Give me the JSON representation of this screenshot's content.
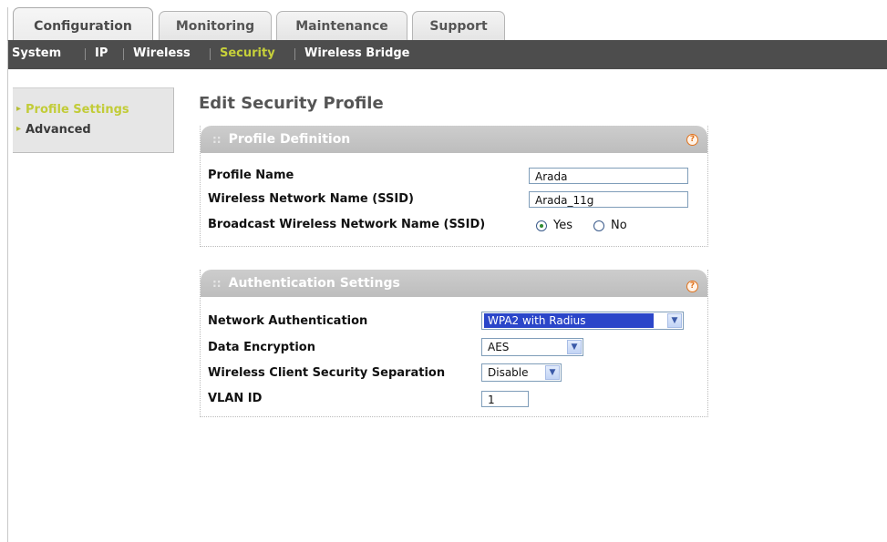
{
  "tabs": [
    {
      "label": "Configuration",
      "active": true
    },
    {
      "label": "Monitoring",
      "active": false
    },
    {
      "label": "Maintenance",
      "active": false
    },
    {
      "label": "Support",
      "active": false
    }
  ],
  "subnav": [
    {
      "label": "System",
      "active": false
    },
    {
      "label": "IP",
      "active": false
    },
    {
      "label": "Wireless",
      "active": false
    },
    {
      "label": "Security",
      "active": true
    },
    {
      "label": "Wireless Bridge",
      "active": false
    }
  ],
  "leftmenu": [
    {
      "label": "Profile Settings",
      "active": true
    },
    {
      "label": "Advanced",
      "active": false
    }
  ],
  "page_title": "Edit Security Profile",
  "profile_definition": {
    "header": "Profile Definition",
    "header_prefix": "::",
    "profile_name_label": "Profile Name",
    "profile_name_value": "Arada",
    "ssid_label": "Wireless Network Name (SSID)",
    "ssid_value": "Arada_11g",
    "broadcast_label": "Broadcast Wireless Network Name (SSID)",
    "broadcast_yes": "Yes",
    "broadcast_no": "No",
    "broadcast_selected": "Yes"
  },
  "authentication_settings": {
    "header": "Authentication Settings",
    "header_prefix": "::",
    "network_auth_label": "Network Authentication",
    "network_auth_value": "WPA2 with Radius",
    "data_encryption_label": "Data Encryption",
    "data_encryption_value": "AES",
    "separation_label": "Wireless Client Security Separation",
    "separation_value": "Disable",
    "vlan_label": "VLAN ID",
    "vlan_value": "1"
  },
  "icons": {
    "help": "help-icon",
    "dropdown": "chevron-down-icon",
    "menu_arrow": "triangle-right-icon"
  },
  "colors": {
    "subnav_bg": "#4d4d4d",
    "active_accent": "#c2cc38",
    "header_gray": "#c4c4c4",
    "help_orange": "#e0731d",
    "selection_blue": "#2b46c9"
  }
}
